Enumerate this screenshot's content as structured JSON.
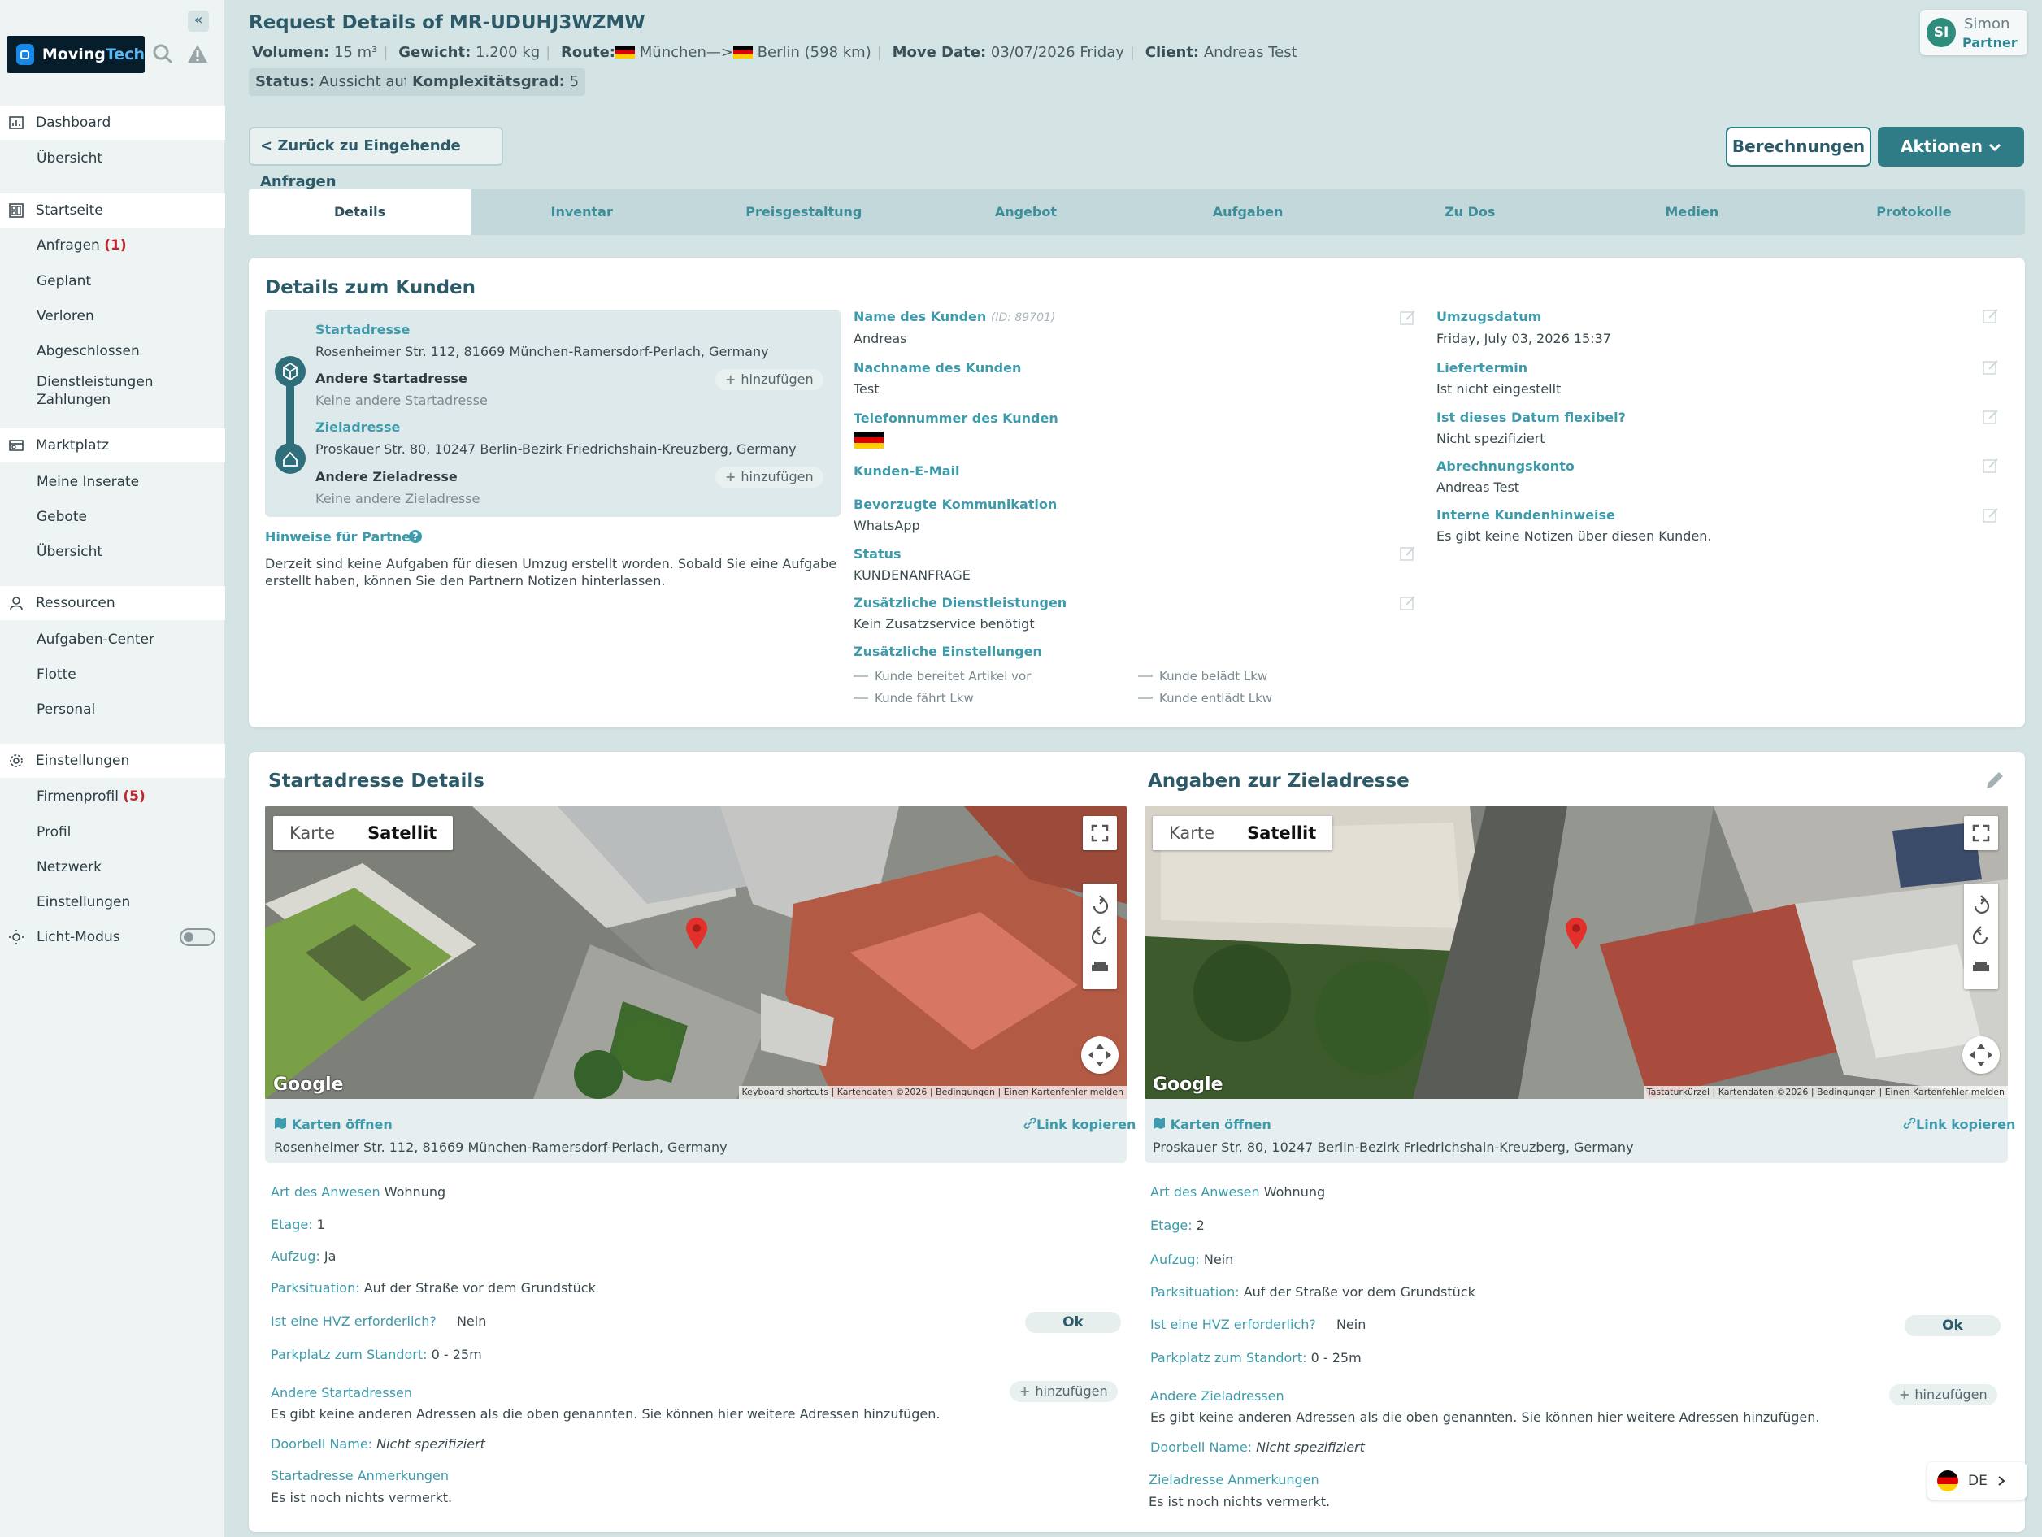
{
  "app": {
    "brand_a": "Moving",
    "brand_b": "Tech"
  },
  "sidebar": {
    "sections": [
      {
        "label": "Dashboard",
        "items": [
          {
            "label": "Übersicht"
          }
        ]
      },
      {
        "label": "Startseite",
        "items": [
          {
            "label": "Anfragen",
            "count": "(1)"
          },
          {
            "label": "Geplant"
          },
          {
            "label": "Verloren"
          },
          {
            "label": "Abgeschlossen"
          },
          {
            "label": "Dienstleistungen Zahlungen"
          }
        ]
      },
      {
        "label": "Marktplatz",
        "items": [
          {
            "label": "Meine Inserate"
          },
          {
            "label": "Gebote"
          },
          {
            "label": "Übersicht"
          }
        ]
      },
      {
        "label": "Ressourcen",
        "items": [
          {
            "label": "Aufgaben-Center"
          },
          {
            "label": "Flotte"
          },
          {
            "label": "Personal"
          }
        ]
      },
      {
        "label": "Einstellungen",
        "items": [
          {
            "label": "Firmenprofil",
            "count": "(5)"
          },
          {
            "label": "Profil"
          },
          {
            "label": "Netzwerk"
          },
          {
            "label": "Einstellungen"
          }
        ]
      }
    ],
    "light_mode": "Licht-Modus"
  },
  "header": {
    "title": "Request Details of MR-UDUHJ3WZMW",
    "volume_label": "Volumen:",
    "volume": "15 m³",
    "weight_label": "Gewicht:",
    "weight": "1.200 kg",
    "route_label": "Route:",
    "route_from": "München—>",
    "route_to": "Berlin (598 km)",
    "move_date_label": "Move Date:",
    "move_date": "03/07/2026 Friday",
    "client_label": "Client:",
    "client": "Andreas Test",
    "status_label": "Status:",
    "status": "Aussicht auf",
    "complexity_label": "Komplexitätsgrad:",
    "complexity": "5"
  },
  "user": {
    "initials": "SI",
    "name": "Simon",
    "role": "Partner"
  },
  "actions": {
    "back": "< Zurück zu Eingehende Anfragen",
    "calculations": "Berechnungen",
    "actions": "Aktionen"
  },
  "tabs": [
    "Details",
    "Inventar",
    "Preisgestaltung",
    "Angebot",
    "Aufgaben",
    "Zu Dos",
    "Medien",
    "Protokolle"
  ],
  "customer": {
    "title": "Details zum Kunden",
    "start_label": "Startadresse",
    "start_address": "Rosenheimer Str. 112, 81669 München-Ramersdorf-Perlach, Germany",
    "other_start_label": "Andere Startadresse",
    "other_start_value": "Keine andere Startadresse",
    "dest_label": "Zieladresse",
    "dest_address": "Proskauer Str. 80, 10247 Berlin-Bezirk Friedrichshain-Kreuzberg, Germany",
    "other_dest_label": "Andere Zieladresse",
    "other_dest_value": "Keine andere Zieladresse",
    "add": "hinzufügen",
    "hints_label": "Hinweise für Partner",
    "hints_text_1": "Derzeit sind keine Aufgaben für diesen Umzug erstellt worden. Sobald Sie eine Aufgabe",
    "hints_text_2": "erstellt haben, können Sie den Partnern Notizen hinterlassen.",
    "name_label": "Name des Kunden",
    "id": "(ID: 89701)",
    "name": "Andreas",
    "surname_label": "Nachname des Kunden",
    "surname": "Test",
    "phone_label": "Telefonnummer des Kunden",
    "email_label": "Kunden-E-Mail",
    "comm_label": "Bevorzugte Kommunikation",
    "comm": "WhatsApp",
    "status_label": "Status",
    "status": "KUNDENANFRAGE",
    "services_label": "Zusätzliche Dienstleistungen",
    "services": "Kein Zusatzservice benötigt",
    "settings_label": "Zusätzliche Einstellungen",
    "setting_1": "Kunde bereitet Artikel vor",
    "setting_2": "Kunde belädt Lkw",
    "setting_3": "Kunde fährt Lkw",
    "setting_4": "Kunde entlädt Lkw",
    "move_date_label": "Umzugsdatum",
    "move_date": "Friday, July 03, 2026 15:37",
    "delivery_label": "Liefertermin",
    "delivery": "Ist nicht eingestellt",
    "flexible_label": "Ist dieses Datum flexibel?",
    "flexible": "Nicht spezifiziert",
    "billing_label": "Abrechnungskonto",
    "billing": "Andreas Test",
    "notes_label": "Interne Kundenhinweise",
    "notes": "Es gibt keine Notizen über diesen Kunden."
  },
  "map_common": {
    "map": "Karte",
    "satellite": "Satellit",
    "google": "Google",
    "open_maps": "Karten öffnen",
    "copy_link": "Link kopieren",
    "attrib_start": "Keyboard shortcuts  |  Kartendaten ©2026  |  Bedingungen  |  Einen Kartenfehler melden",
    "attrib_dest": "Tastaturkürzel  |  Kartendaten ©2026  |  Bedingungen  |  Einen Kartenfehler melden"
  },
  "start_details": {
    "title": "Startadresse Details",
    "address": "Rosenheimer Str. 112, 81669 München-Ramersdorf-Perlach, Germany",
    "property_label": "Art des Anwesen",
    "property": "Wohnung",
    "floor_label": "Etage:",
    "floor": "1",
    "elevator_label": "Aufzug:",
    "elevator": "Ja",
    "parking_label": "Parksituation:",
    "parking": "Auf der Straße vor dem Grundstück",
    "hvz_label": "Ist eine HVZ erforderlich?",
    "hvz": "Nein",
    "ok": "Ok",
    "distance_label": "Parkplatz zum Standort:",
    "distance": "0 - 25m",
    "other_label": "Andere Startadressen",
    "other_text": "Es gibt keine anderen Adressen als die oben genannten. Sie können hier weitere Adressen hinzufügen.",
    "doorbell_label": "Doorbell Name:",
    "doorbell": "Nicht spezifiziert",
    "remarks_label": "Startadresse Anmerkungen",
    "remarks": "Es ist noch nichts vermerkt."
  },
  "dest_details": {
    "title": "Angaben zur Zieladresse",
    "address": "Proskauer Str. 80, 10247 Berlin-Bezirk Friedrichshain-Kreuzberg, Germany",
    "property_label": "Art des Anwesen",
    "property": "Wohnung",
    "floor_label": "Etage:",
    "floor": "2",
    "elevator_label": "Aufzug:",
    "elevator": "Nein",
    "parking_label": "Parksituation:",
    "parking": "Auf der Straße vor dem Grundstück",
    "hvz_label": "Ist eine HVZ erforderlich?",
    "hvz": "Nein",
    "ok": "Ok",
    "distance_label": "Parkplatz zum Standort:",
    "distance": "0 - 25m",
    "other_label": "Andere Zieladressen",
    "other_text": "Es gibt keine anderen Adressen als die oben genannten. Sie können hier weitere Adressen hinzufügen.",
    "doorbell_label": "Doorbell Name:",
    "doorbell": "Nicht spezifiziert",
    "remarks_label": "Zieladresse Anmerkungen",
    "remarks": "Es ist noch nichts vermerkt."
  },
  "language": "DE"
}
